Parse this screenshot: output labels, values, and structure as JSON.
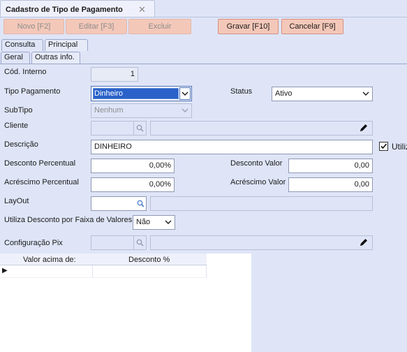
{
  "window": {
    "tab_title": "Cadastro de Tipo de Pagamento",
    "close_glyph": "✕"
  },
  "toolbar": {
    "novo": "Novo [F2]",
    "editar": "Editar [F3]",
    "excluir": "Excluir",
    "gravar": "Gravar [F10]",
    "cancelar": "Cancelar [F9]"
  },
  "tabs": {
    "consulta": "Consulta",
    "principal": "Principal",
    "geral": "Geral",
    "outras": "Outras info."
  },
  "form": {
    "cod_interno": {
      "label": "Cód. Interno",
      "value": "1"
    },
    "tipo_pagamento": {
      "label": "Tipo  Pagamento",
      "value": "Dinheiro"
    },
    "status": {
      "label": "Status",
      "value": "Ativo"
    },
    "subtipo": {
      "label": "SubTipo",
      "value": "Nenhum"
    },
    "cliente": {
      "label": "Cliente",
      "value": ""
    },
    "descricao": {
      "label": "Descrição",
      "value": "DINHEIRO"
    },
    "utiliza_checkbox": {
      "label": "Utiliz",
      "checked": true
    },
    "desconto_percentual": {
      "label": "Desconto Percentual",
      "value": "0,00%"
    },
    "desconto_valor": {
      "label": "Desconto Valor",
      "value": "0,00"
    },
    "acrescimo_percentual": {
      "label": "Acréscimo Percentual",
      "value": "0,00%"
    },
    "acrescimo_valor": {
      "label": "Acréscimo Valor",
      "value": "0,00"
    },
    "layout": {
      "label": "LayOut",
      "value": ""
    },
    "faixa_valores": {
      "label": "Utiliza Desconto por Faixa de Valores",
      "value": "Não"
    },
    "config_pix": {
      "label": "Configuração Pix",
      "value": ""
    }
  },
  "grid": {
    "columns": [
      "Valor acima de:",
      "Desconto %"
    ],
    "row_indicator": "▶"
  },
  "icons": {
    "search": "magnifier-icon",
    "edit": "pencil-icon",
    "dropdown": "chevron-down-icon"
  }
}
